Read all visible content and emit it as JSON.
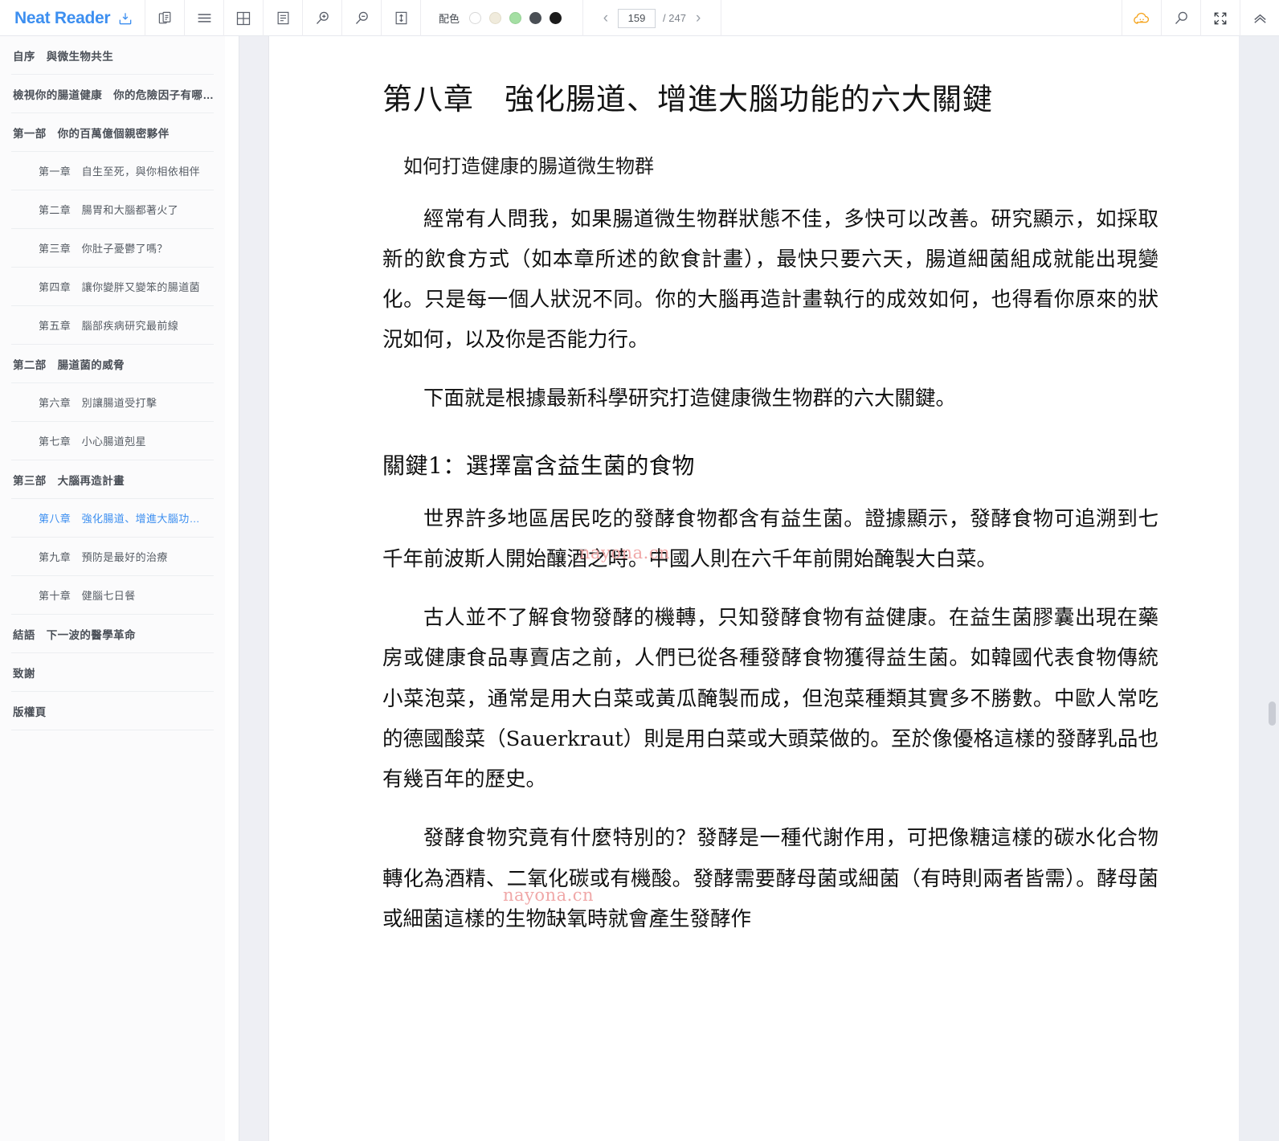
{
  "app": {
    "brand": "Neat Reader",
    "brand_color": "#3d8ff0",
    "save_icon": "save-download-icon"
  },
  "toolbar": {
    "icons": [
      {
        "name": "copy-pages-icon",
        "title": "雙頁/複製"
      },
      {
        "name": "list-lines-icon",
        "title": "目錄"
      },
      {
        "name": "grid-layout-icon",
        "title": "網格版面"
      },
      {
        "name": "text-align-icon",
        "title": "文字版面"
      },
      {
        "name": "zoom-in-icon",
        "title": "放大"
      },
      {
        "name": "zoom-out-icon",
        "title": "縮小"
      },
      {
        "name": "line-height-icon",
        "title": "行距"
      }
    ],
    "color_scheme": {
      "label": "配色",
      "swatches": [
        {
          "name": "theme-white",
          "hex": "#ffffff"
        },
        {
          "name": "theme-cream",
          "hex": "#f0ebdc"
        },
        {
          "name": "theme-green",
          "hex": "#a4dfa3"
        },
        {
          "name": "theme-gray",
          "hex": "#4a4f55"
        },
        {
          "name": "theme-black",
          "hex": "#1b1b1b"
        }
      ]
    },
    "pager": {
      "prev": "‹",
      "next": "›",
      "current_page": "159",
      "total_pages": "/ 247",
      "placeholder": "159"
    },
    "right_icons": [
      {
        "name": "cloud-sync-icon",
        "color": "#f5a623"
      },
      {
        "name": "search-icon",
        "color": "#5a5f6a"
      },
      {
        "name": "fullscreen-icon",
        "color": "#3a3f46"
      },
      {
        "name": "collapse-up-icon",
        "color": "#5a5f6a"
      }
    ]
  },
  "sidebar": {
    "items": [
      {
        "label": "自序　與微生物共生",
        "level": 0,
        "active": false
      },
      {
        "label": "檢視你的腸道健康　你的危險因子有哪…",
        "level": 0,
        "active": false
      },
      {
        "label": "第一部　你的百萬億個親密夥伴",
        "level": 0,
        "active": false
      },
      {
        "label": "第一章　自生至死，與你相依相伴",
        "level": 1,
        "active": false
      },
      {
        "label": "第二章　腸胃和大腦都著火了",
        "level": 1,
        "active": false
      },
      {
        "label": "第三章　你肚子憂鬱了嗎？",
        "level": 1,
        "active": false
      },
      {
        "label": "第四章　讓你變胖又變笨的腸道菌",
        "level": 1,
        "active": false
      },
      {
        "label": "第五章　腦部疾病研究最前線",
        "level": 1,
        "active": false
      },
      {
        "label": "第二部　腸道菌的威脅",
        "level": 0,
        "active": false
      },
      {
        "label": "第六章　別讓腸道受打擊",
        "level": 1,
        "active": false
      },
      {
        "label": "第七章　小心腸道剋星",
        "level": 1,
        "active": false
      },
      {
        "label": "第三部　大腦再造計畫",
        "level": 0,
        "active": false
      },
      {
        "label": "第八章　強化腸道、增進大腦功…",
        "level": 1,
        "active": true
      },
      {
        "label": "第九章　預防是最好的治療",
        "level": 1,
        "active": false
      },
      {
        "label": "第十章　健腦七日餐",
        "level": 1,
        "active": false
      },
      {
        "label": "結語　下一波的醫學革命",
        "level": 0,
        "active": false
      },
      {
        "label": "致謝",
        "level": 0,
        "active": false
      },
      {
        "label": "版權頁",
        "level": 0,
        "active": false
      }
    ]
  },
  "content": {
    "chapter_title": "第八章　強化腸道、增進大腦功能的六大關鍵",
    "subheading": "如何打造健康的腸道微生物群",
    "paragraph_1": "經常有人問我，如果腸道微生物群狀態不佳，多快可以改善。研究顯示，如採取新的飲食方式（如本章所述的飲食計畫），最快只要六天，腸道細菌組成就能出現變化。只是每一個人狀況不同。你的大腦再造計畫執行的成效如何，也得看你原來的狀況如何，以及你是否能力行。",
    "paragraph_2": "下面就是根據最新科學研究打造健康微生物群的六大關鍵。",
    "key_heading_1": "關鍵1：選擇富含益生菌的食物",
    "paragraph_3": "世界許多地區居民吃的發酵食物都含有益生菌。證據顯示，發酵食物可追溯到七千年前波斯人開始釀酒之時。中國人則在六千年前開始醃製大白菜。",
    "paragraph_4": "古人並不了解食物發酵的機轉，只知發酵食物有益健康。在益生菌膠囊出現在藥房或健康食品專賣店之前，人們已從各種發酵食物獲得益生菌。如韓國代表食物傳統小菜泡菜，通常是用大白菜或黃瓜醃製而成，但泡菜種類其實多不勝數。中歐人常吃的德國酸菜（Sauerkraut）則是用白菜或大頭菜做的。至於像優格這樣的發酵乳品也有幾百年的歷史。",
    "paragraph_5": "發酵食物究竟有什麼特別的？發酵是一種代謝作用，可把像糖這樣的碳水化合物轉化為酒精、二氧化碳或有機酸。發酵需要酵母菌或細菌（有時則兩者皆需）。酵母菌或細菌這樣的生物缺氧時就會產生發酵作",
    "watermark": "nayona.cn",
    "watermark_color": "#f0a8a8"
  }
}
